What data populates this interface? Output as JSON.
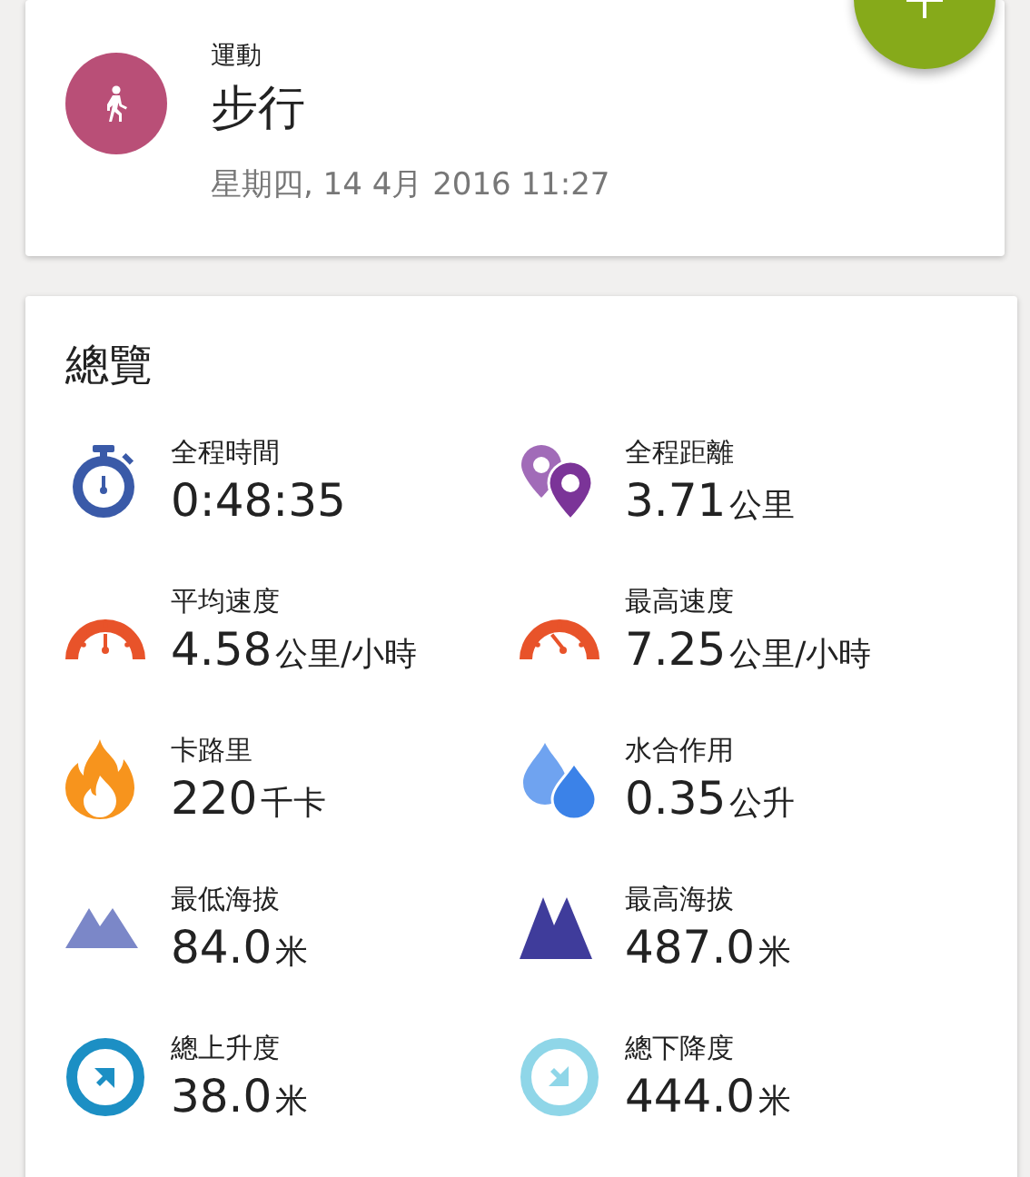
{
  "activity": {
    "category": "運動",
    "name": "步行",
    "datetime": "星期四, 14 4月 2016 11:27"
  },
  "overview": {
    "title": "總覽",
    "stats": [
      {
        "kind": "stopwatch",
        "label": "全程時間",
        "value": "0:48:35"
      },
      {
        "kind": "pins",
        "label": "全程距離",
        "value": "3.71",
        "unit": "公里"
      },
      {
        "kind": "gauge-avg",
        "label": "平均速度",
        "value": "4.58",
        "unit": "公里/小時"
      },
      {
        "kind": "gauge-max",
        "label": "最高速度",
        "value": "7.25",
        "unit": "公里/小時"
      },
      {
        "kind": "flame",
        "label": "卡路里",
        "value": "220",
        "unit": "千卡"
      },
      {
        "kind": "drops",
        "label": "水合作用",
        "value": "0.35",
        "unit": "公升"
      },
      {
        "kind": "mountain-low",
        "label": "最低海拔",
        "value": "84.0",
        "unit": "米"
      },
      {
        "kind": "mountain-high",
        "label": "最高海拔",
        "value": "487.0",
        "unit": "米"
      },
      {
        "kind": "ascent",
        "label": "總上升度",
        "value": "38.0",
        "unit": "米"
      },
      {
        "kind": "descent",
        "label": "總下降度",
        "value": "444.0",
        "unit": "米"
      }
    ]
  }
}
